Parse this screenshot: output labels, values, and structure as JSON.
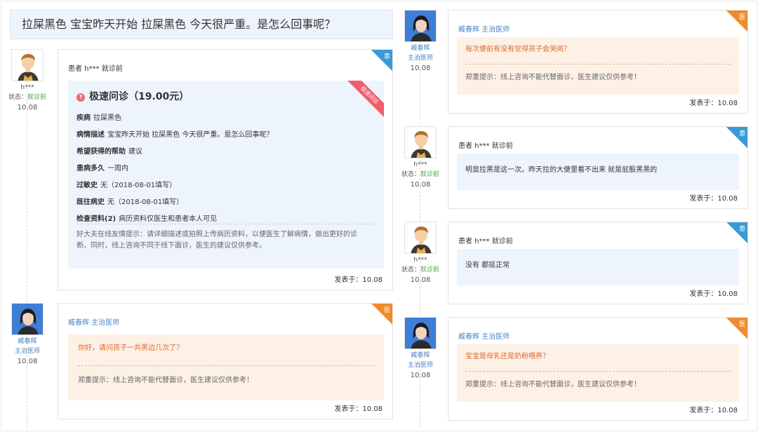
{
  "question": "拉屎黑色 宝宝昨天开始 拉屎黑色 今天很严重。是怎么回事呢？",
  "labels": {
    "patient_badge": "患",
    "doctor_badge": "医",
    "status_label": "状态：",
    "post_prefix": "发表于："
  },
  "patient": {
    "name": "h***",
    "status": "就诊前",
    "header": "患者 h*** 就诊前"
  },
  "doctor": {
    "name": "臧春辉",
    "title": "主治医师",
    "header": "臧春辉 主治医师"
  },
  "consult": {
    "title": "极速问诊（19.00元）",
    "ribbon": "极速问诊",
    "fields": [
      {
        "label": "疾病",
        "value": "拉屎黑色"
      },
      {
        "label": "病情描述",
        "value": "宝宝昨天开始 拉屎黑色 今天很严重。是怎么回事呢？"
      },
      {
        "label": "希望获得的帮助",
        "value": "建议"
      },
      {
        "label": "患病多久",
        "value": "一周内"
      },
      {
        "label": "过敏史",
        "value": "无（2018-08-01填写）"
      },
      {
        "label": "既往病史",
        "value": "无（2018-08-01填写）"
      },
      {
        "label": "检查资料(2)",
        "value": "病历资料仅医生和患者本人可见"
      }
    ],
    "tip": "好大夫在线友情提示：请详细描述或拍照上传病历资料，以便医生了解病情，做出更好的诊断。同时，线上咨询不同于线下面诊，医生的建议仅供参考。",
    "date": "10.08",
    "posted": "发表于：10.08"
  },
  "doctor_notice": "郑重提示：线上咨询不能代替面诊，医生建议仅供参考！",
  "messages": [
    {
      "role": "doctor",
      "text": "你好，请问孩子一共黑边几次了？",
      "date": "10.08",
      "posted": "发表于：10.08"
    },
    {
      "role": "doctor",
      "text": "每次便前有没有觉得孩子会哭闹？",
      "date": "10.08",
      "posted": "发表于：10.08"
    },
    {
      "role": "patient",
      "text": "明显拉黑是这一次。昨天拉的大便里看不出来 就是屁股黑黑的",
      "date": "10.08",
      "posted": "发表于：10.08"
    },
    {
      "role": "patient",
      "text": "没有 都挺正常",
      "date": "10.08",
      "posted": "发表于：10.08"
    },
    {
      "role": "doctor",
      "text": "宝宝是母乳还是奶粉喂养？",
      "date": "10.08",
      "posted": "发表于：10.08"
    }
  ],
  "colors": {
    "patient_accent": "#3a9ad9",
    "doctor_accent": "#f08b2a",
    "doctor_text": "#e0682b",
    "doctor_name": "#4a86c8",
    "status_green": "#47a447",
    "ribbon": "#f05d6c"
  }
}
